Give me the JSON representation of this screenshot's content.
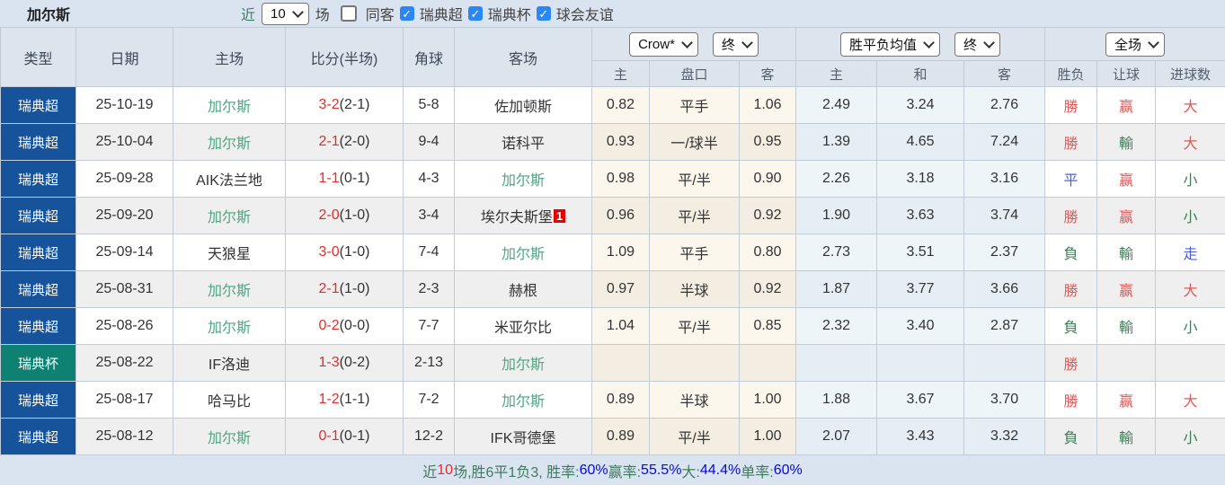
{
  "title": "加尔斯",
  "controls": {
    "recent_label": "近",
    "recent_value": "10",
    "matches_label": "场",
    "same_away": {
      "label": "同客",
      "checked": false
    },
    "leagues": [
      {
        "label": "瑞典超",
        "checked": true
      },
      {
        "label": "瑞典杯",
        "checked": true
      },
      {
        "label": "球会友谊",
        "checked": true
      }
    ],
    "check_glyph": "✓"
  },
  "table_header": {
    "type": "类型",
    "date": "日期",
    "home": "主场",
    "score": "比分(半场)",
    "corners": "角球",
    "away": "客场",
    "asian_select": "Crow*",
    "asian_stage_select": "终",
    "euro_select": "胜平负均值",
    "euro_stage_select": "终",
    "scope_select": "全场",
    "sub_asian": [
      "主",
      "盘口",
      "客"
    ],
    "sub_euro": [
      "主",
      "和",
      "客"
    ],
    "sub_result": [
      "胜负",
      "让球",
      "进球数"
    ]
  },
  "rows": [
    {
      "type": "瑞典超",
      "type_style": "super",
      "date": "25-10-19",
      "home": "加尔斯",
      "home_hl": true,
      "score": "3-2",
      "half": "(2-1)",
      "corners": "5-8",
      "away": "佐加顿斯",
      "away_hl": false,
      "away_badge": "",
      "asian": {
        "home": "0.82",
        "line": "平手",
        "away": "1.06"
      },
      "euro": {
        "home": "2.49",
        "draw": "3.24",
        "away": "2.76"
      },
      "results": [
        {
          "text": "勝",
          "tone": "red"
        },
        {
          "text": "赢",
          "tone": "red"
        },
        {
          "text": "大",
          "tone": "red"
        }
      ]
    },
    {
      "type": "瑞典超",
      "type_style": "super",
      "date": "25-10-04",
      "home": "加尔斯",
      "home_hl": true,
      "score": "2-1",
      "half": "(2-0)",
      "corners": "9-4",
      "away": "诺科平",
      "away_hl": false,
      "away_badge": "",
      "asian": {
        "home": "0.93",
        "line": "一/球半",
        "away": "0.95"
      },
      "euro": {
        "home": "1.39",
        "draw": "4.65",
        "away": "7.24"
      },
      "results": [
        {
          "text": "勝",
          "tone": "red"
        },
        {
          "text": "輸",
          "tone": "green"
        },
        {
          "text": "大",
          "tone": "red"
        }
      ]
    },
    {
      "type": "瑞典超",
      "type_style": "super",
      "date": "25-09-28",
      "home": "AIK法兰地",
      "home_hl": false,
      "score": "1-1",
      "half": "(0-1)",
      "corners": "4-3",
      "away": "加尔斯",
      "away_hl": true,
      "away_badge": "",
      "asian": {
        "home": "0.98",
        "line": "平/半",
        "away": "0.90"
      },
      "euro": {
        "home": "2.26",
        "draw": "3.18",
        "away": "3.16"
      },
      "results": [
        {
          "text": "平",
          "tone": "blue"
        },
        {
          "text": "赢",
          "tone": "red"
        },
        {
          "text": "小",
          "tone": "green"
        }
      ]
    },
    {
      "type": "瑞典超",
      "type_style": "super",
      "date": "25-09-20",
      "home": "加尔斯",
      "home_hl": true,
      "score": "2-0",
      "half": "(1-0)",
      "corners": "3-4",
      "away": "埃尔夫斯堡",
      "away_hl": false,
      "away_badge": "1",
      "asian": {
        "home": "0.96",
        "line": "平/半",
        "away": "0.92"
      },
      "euro": {
        "home": "1.90",
        "draw": "3.63",
        "away": "3.74"
      },
      "results": [
        {
          "text": "勝",
          "tone": "red"
        },
        {
          "text": "赢",
          "tone": "red"
        },
        {
          "text": "小",
          "tone": "green"
        }
      ]
    },
    {
      "type": "瑞典超",
      "type_style": "super",
      "date": "25-09-14",
      "home": "天狼星",
      "home_hl": false,
      "score": "3-0",
      "half": "(1-0)",
      "corners": "7-4",
      "away": "加尔斯",
      "away_hl": true,
      "away_badge": "",
      "asian": {
        "home": "1.09",
        "line": "平手",
        "away": "0.80"
      },
      "euro": {
        "home": "2.73",
        "draw": "3.51",
        "away": "2.37"
      },
      "results": [
        {
          "text": "負",
          "tone": "green"
        },
        {
          "text": "輸",
          "tone": "green"
        },
        {
          "text": "走",
          "tone": "blue"
        }
      ]
    },
    {
      "type": "瑞典超",
      "type_style": "super",
      "date": "25-08-31",
      "home": "加尔斯",
      "home_hl": true,
      "score": "2-1",
      "half": "(1-0)",
      "corners": "2-3",
      "away": "赫根",
      "away_hl": false,
      "away_badge": "",
      "asian": {
        "home": "0.97",
        "line": "半球",
        "away": "0.92"
      },
      "euro": {
        "home": "1.87",
        "draw": "3.77",
        "away": "3.66"
      },
      "results": [
        {
          "text": "勝",
          "tone": "red"
        },
        {
          "text": "赢",
          "tone": "red"
        },
        {
          "text": "大",
          "tone": "red"
        }
      ]
    },
    {
      "type": "瑞典超",
      "type_style": "super",
      "date": "25-08-26",
      "home": "加尔斯",
      "home_hl": true,
      "score": "0-2",
      "half": "(0-0)",
      "corners": "7-7",
      "away": "米亚尔比",
      "away_hl": false,
      "away_badge": "",
      "asian": {
        "home": "1.04",
        "line": "平/半",
        "away": "0.85"
      },
      "euro": {
        "home": "2.32",
        "draw": "3.40",
        "away": "2.87"
      },
      "results": [
        {
          "text": "負",
          "tone": "green"
        },
        {
          "text": "輸",
          "tone": "green"
        },
        {
          "text": "小",
          "tone": "green"
        }
      ]
    },
    {
      "type": "瑞典杯",
      "type_style": "cup",
      "date": "25-08-22",
      "home": "IF洛迪",
      "home_hl": false,
      "score": "1-3",
      "half": "(0-2)",
      "corners": "2-13",
      "away": "加尔斯",
      "away_hl": true,
      "away_badge": "",
      "asian": {
        "home": "",
        "line": "",
        "away": ""
      },
      "euro": {
        "home": "",
        "draw": "",
        "away": ""
      },
      "results": [
        {
          "text": "勝",
          "tone": "red"
        },
        {
          "text": "",
          "tone": ""
        },
        {
          "text": "",
          "tone": ""
        }
      ]
    },
    {
      "type": "瑞典超",
      "type_style": "super",
      "date": "25-08-17",
      "home": "哈马比",
      "home_hl": false,
      "score": "1-2",
      "half": "(1-1)",
      "corners": "7-2",
      "away": "加尔斯",
      "away_hl": true,
      "away_badge": "",
      "asian": {
        "home": "0.89",
        "line": "半球",
        "away": "1.00"
      },
      "euro": {
        "home": "1.88",
        "draw": "3.67",
        "away": "3.70"
      },
      "results": [
        {
          "text": "勝",
          "tone": "red"
        },
        {
          "text": "赢",
          "tone": "red"
        },
        {
          "text": "大",
          "tone": "red"
        }
      ]
    },
    {
      "type": "瑞典超",
      "type_style": "super",
      "date": "25-08-12",
      "home": "加尔斯",
      "home_hl": true,
      "score": "0-1",
      "half": "(0-1)",
      "corners": "12-2",
      "away": "IFK哥德堡",
      "away_hl": false,
      "away_badge": "",
      "asian": {
        "home": "0.89",
        "line": "平/半",
        "away": "1.00"
      },
      "euro": {
        "home": "2.07",
        "draw": "3.43",
        "away": "3.32"
      },
      "results": [
        {
          "text": "負",
          "tone": "green"
        },
        {
          "text": "輸",
          "tone": "green"
        },
        {
          "text": "小",
          "tone": "green"
        }
      ]
    }
  ],
  "footer_parts": [
    {
      "text": "近",
      "tone": "label"
    },
    {
      "text": "10",
      "tone": "red"
    },
    {
      "text": "场,胜6平1负3, 胜率:",
      "tone": "label"
    },
    {
      "text": "60%",
      "tone": "blue"
    },
    {
      "text": " 赢率:",
      "tone": "label"
    },
    {
      "text": "55.5%",
      "tone": "blue"
    },
    {
      "text": " 大:",
      "tone": "label"
    },
    {
      "text": "44.4%",
      "tone": "blue"
    },
    {
      "text": " 单率:",
      "tone": "label"
    },
    {
      "text": "60%",
      "tone": "blue"
    }
  ]
}
